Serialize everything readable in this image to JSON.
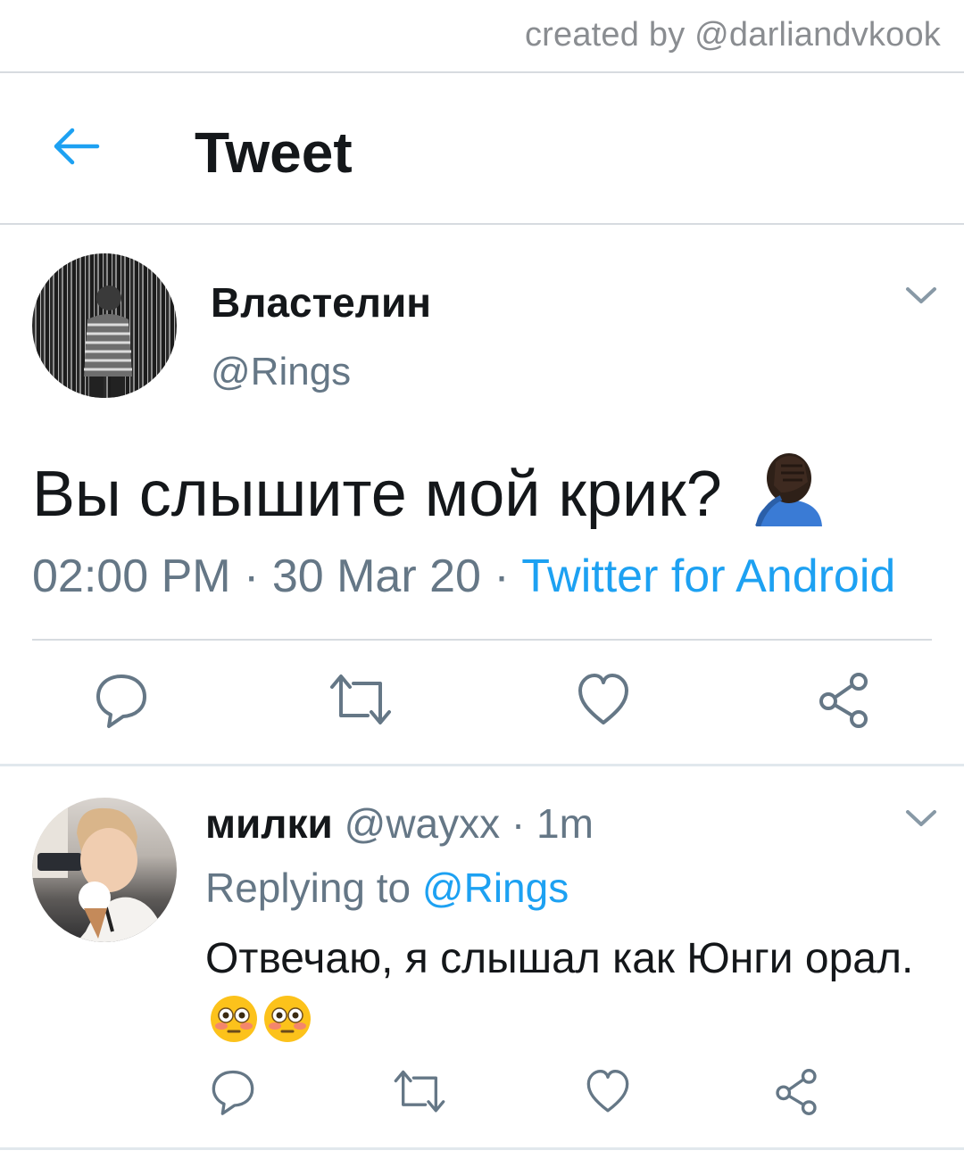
{
  "credit": "created by @darliandvkook",
  "header": {
    "title": "Tweet"
  },
  "tweet": {
    "display_name": "Властелин",
    "handle": "@Rings",
    "text": "Вы слышите мой крик?",
    "time": "02:00 PM",
    "date": "30 Mar 20",
    "source": "Twitter for Android",
    "separator": "·"
  },
  "reply": {
    "display_name": "милки",
    "handle": "@wayxx",
    "age": "1m",
    "replying_label": "Replying to",
    "replying_to": "@Rings",
    "text": "Отвечаю, я слышал как Юнги орал."
  },
  "colors": {
    "accent": "#1da1f2",
    "muted": "#657786",
    "divider": "#d7dbe0"
  },
  "icons": [
    "back-arrow-icon",
    "chevron-down-icon",
    "reply-icon",
    "retweet-icon",
    "like-icon",
    "share-icon",
    "facepalm-emoji",
    "flushed-emoji"
  ]
}
